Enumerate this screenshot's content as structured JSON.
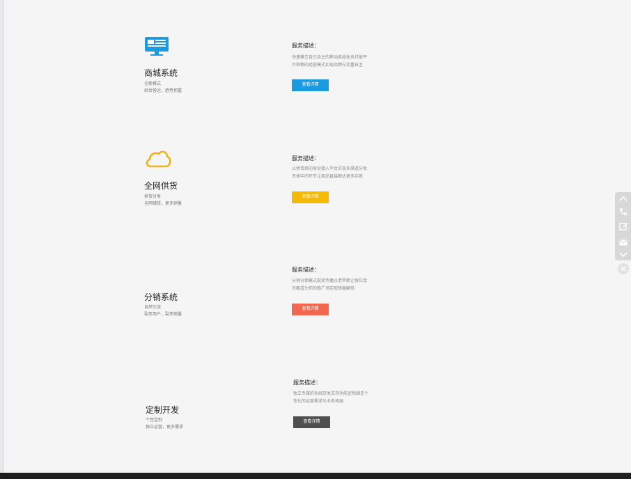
{
  "services": [
    {
      "icon": "monitor-icon",
      "title": "商城系统",
      "sub1": "全新模式",
      "sub2": "综合营运，趋势把握",
      "desc_head": "服务描述：",
      "desc": "快速建立自己自主的移动商城体系打破平台依赖的经营模式实现品牌与流量自主",
      "button": "查看详情",
      "button_color": "#1a9be0"
    },
    {
      "icon": "cloud-icon",
      "title": "全网供货",
      "sub1": "供货分发",
      "sub2": "全网铺货，更多销量",
      "desc_head": "服务描述：",
      "desc": "以供货商的身份接入平台实现多渠道分发去掉中间环节让商品直接触达更多买家",
      "button": "查看详情",
      "button_color": "#f5b900"
    },
    {
      "icon": "",
      "title": "分销系统",
      "sub1": "自然引流",
      "sub2": "裂变用户，裂变销量",
      "desc_head": "服务描述：",
      "desc": "分销分佣模式裂变传播以老带新让每位会员都成为你的推广员实现销量翻倍",
      "button": "查看详情",
      "button_color": "#f2684f"
    },
    {
      "icon": "",
      "title": "定制开发",
      "sub1": "个性定制",
      "sub2": "独立运营，更多需求",
      "desc_head": "服务描述：",
      "desc": "独立专属的系统研发支持功能定制满足个性化的运营需求与业务拓展",
      "button": "查看详情",
      "button_color": "#4f4f4f"
    }
  ],
  "side_tools": [
    "chevron-up-icon",
    "phone-icon",
    "edit-icon",
    "mail-icon",
    "chevron-down-icon"
  ],
  "close_icon": "close-icon"
}
